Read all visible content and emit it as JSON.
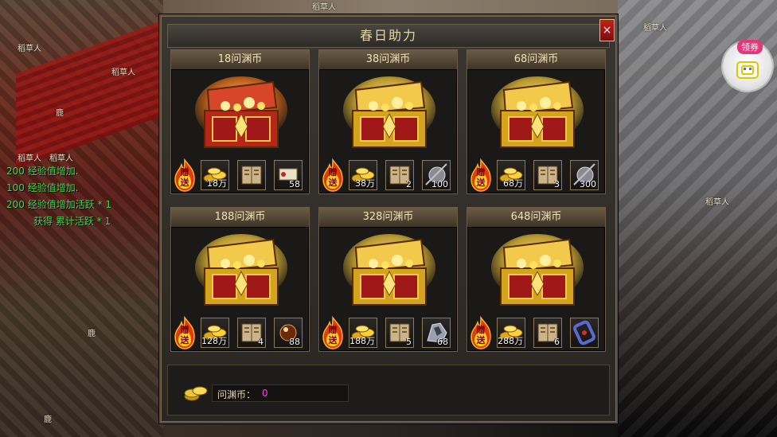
{
  "panel": {
    "title": "春日助力",
    "close_label": "×"
  },
  "chat_log": [
    {
      "text": "200 经验值增加."
    },
    {
      "text": "100 经验值增加."
    },
    {
      "text": "200 经验值增加活跃 * 1"
    },
    {
      "text": "获得 累计活跃 * 1"
    }
  ],
  "npc_labels": [
    "稻草人",
    "稻草人",
    "稻草人",
    "稻草人",
    "鹿",
    "鹿",
    "鹿",
    "稻草人",
    "稻草人",
    "稻草人"
  ],
  "gift_label": "赠送",
  "packs": [
    {
      "price": "18问渊币",
      "coin": "18万",
      "book": "",
      "extra": "58",
      "extra_icon": "scroll-icon"
    },
    {
      "price": "38问渊币",
      "coin": "38万",
      "book": "2",
      "extra": "100",
      "extra_icon": "hammer-icon"
    },
    {
      "price": "68问渊币",
      "coin": "68万",
      "book": "3",
      "extra": "300",
      "extra_icon": "hammer-icon"
    },
    {
      "price": "188问渊币",
      "coin": "128万",
      "book": "4",
      "extra": "88",
      "extra_icon": "orb-icon"
    },
    {
      "price": "328问渊币",
      "coin": "188万",
      "book": "5",
      "extra": "68",
      "extra_icon": "ore-icon"
    },
    {
      "price": "648问渊币",
      "coin": "288万",
      "book": "6",
      "extra": "",
      "extra_icon": "bracelet-icon"
    }
  ],
  "footer": {
    "currency_label": "问渊币：",
    "currency_value": "0"
  },
  "coupon": {
    "label": "领券"
  },
  "colors": {
    "chat": "#3ed94a",
    "currency_value": "#ff3ef0",
    "title": "#e6d6a8"
  }
}
